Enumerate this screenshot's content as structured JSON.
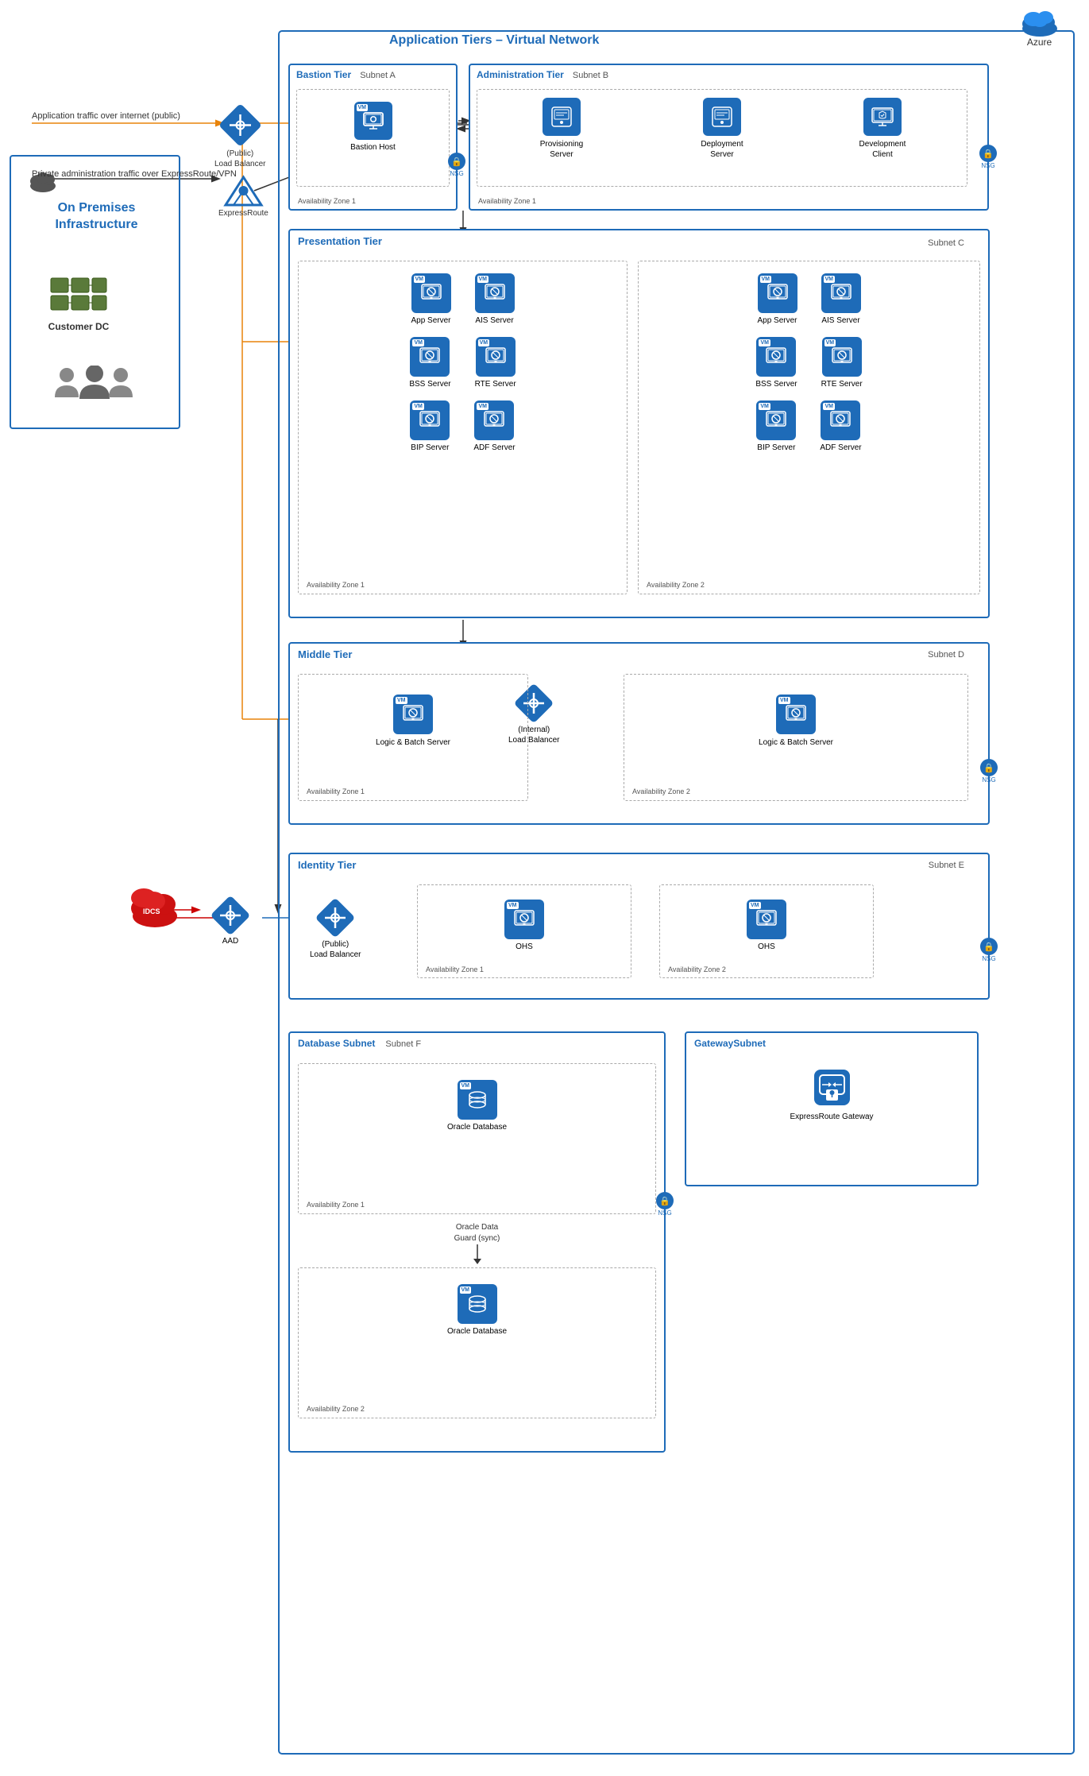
{
  "azure": {
    "label": "Azure",
    "app_tiers_title": "Application Tiers – Virtual Network"
  },
  "on_premises": {
    "title": "On Premises\nInfrastructure",
    "customer_dc": "Customer DC"
  },
  "tiers": {
    "bastion": {
      "title": "Bastion Tier",
      "subnet": "Subnet A",
      "host": "Bastion Host",
      "zone": "Availability Zone 1",
      "nsg": "NSG"
    },
    "admin": {
      "title": "Administration Tier",
      "subnet": "Subnet B",
      "servers": [
        "Provisioning\nServer",
        "Deployment\nServer",
        "Development\nClient"
      ],
      "zone": "Availability Zone 1",
      "nsg": "NSG"
    },
    "presentation": {
      "title": "Presentation Tier",
      "subnet": "Subnet C",
      "zone1": {
        "label": "Availability Zone 1",
        "servers": [
          "App Server",
          "AIS Server",
          "BSS Server",
          "RTE Server",
          "BIP Server",
          "ADF Server"
        ]
      },
      "zone2": {
        "label": "Availability Zone 2",
        "servers": [
          "App Server",
          "AIS Server",
          "BSS Server",
          "RTE Server",
          "BIP Server",
          "ADF Server"
        ]
      }
    },
    "middle": {
      "title": "Middle Tier",
      "subnet": "Subnet D",
      "lb_label": "(Internal)\nLoad Balancer",
      "zone1": {
        "label": "Availability Zone 1",
        "server": "Logic & Batch Server"
      },
      "zone2": {
        "label": "Availability Zone 2",
        "server": "Logic & Batch Server"
      },
      "nsg": "NSG"
    },
    "identity": {
      "title": "Identity Tier",
      "subnet": "Subnet E",
      "zone1": {
        "label": "Availability Zone 1",
        "server": "OHS"
      },
      "zone2": {
        "label": "Availability Zone 2",
        "server": "OHS"
      },
      "nsg": "NSG"
    },
    "database": {
      "title": "Database Subnet",
      "subnet": "Subnet F",
      "zone1": {
        "label": "Availability Zone 1",
        "server": "Oracle Database"
      },
      "sync_label": "Oracle Data\nGuard (sync)",
      "zone2": {
        "label": "Availability Zone 2",
        "server": "Oracle Database"
      },
      "nsg": "NSG"
    },
    "gateway": {
      "title": "GatewaySubnet",
      "server": "ExpressRoute Gateway"
    }
  },
  "network": {
    "public_lb": "(Public)\nLoad Balancer",
    "internal_lb": "(Internal)\nLoad Balancer",
    "public_lb_identity": "(Public)\nLoad Balancer",
    "expressroute": "ExpressRoute",
    "aad": "AAD",
    "idcs_label": "IDCS",
    "traffic_label": "Application traffic over internet (public)",
    "private_traffic_label": "Private administration traffic over ExpressRoute/VPN"
  },
  "icons": {
    "cloud": "☁",
    "vm": "VM",
    "server": "⚙",
    "lock": "🔒",
    "router": "⊕",
    "database": "🗄",
    "people": "👥",
    "shield": "🛡"
  }
}
